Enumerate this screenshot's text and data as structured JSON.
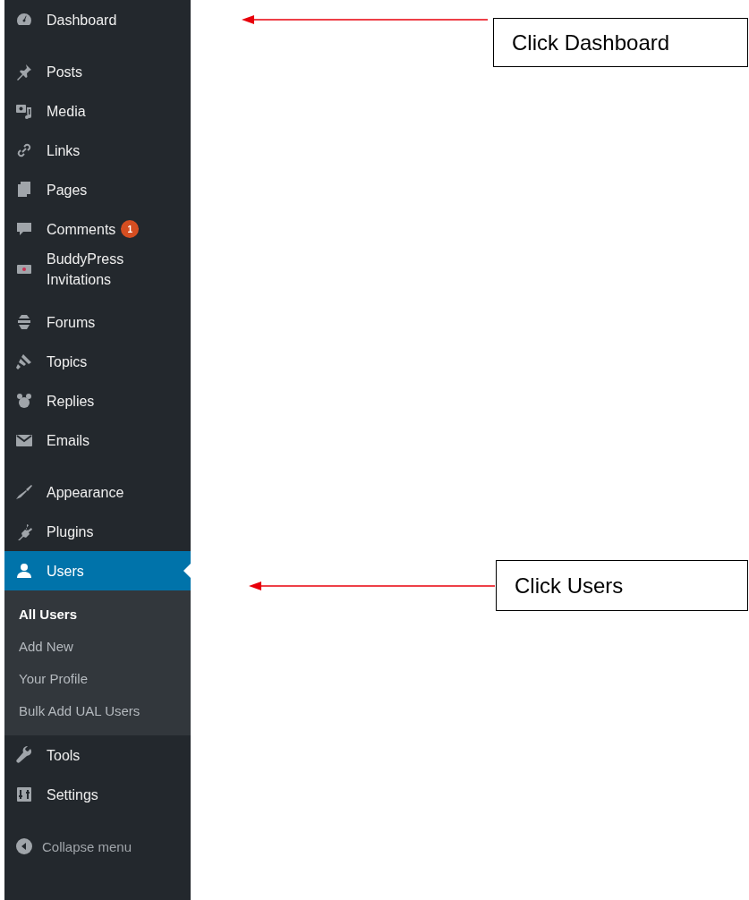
{
  "sidebar": {
    "sections": [
      {
        "items": [
          {
            "label": "Dashboard",
            "selected": false
          }
        ]
      },
      {
        "items": [
          {
            "label": "Posts",
            "selected": false
          },
          {
            "label": "Media",
            "selected": false
          },
          {
            "label": "Links",
            "selected": false
          },
          {
            "label": "Pages",
            "selected": false
          },
          {
            "label": "Comments",
            "selected": false,
            "badge": "1"
          },
          {
            "label": "BuddyPress Invitations",
            "selected": false
          }
        ]
      },
      {
        "items": [
          {
            "label": "Forums",
            "selected": false
          },
          {
            "label": "Topics",
            "selected": false
          },
          {
            "label": "Replies",
            "selected": false
          },
          {
            "label": "Emails",
            "selected": false
          }
        ]
      },
      {
        "items": [
          {
            "label": "Appearance",
            "selected": false
          },
          {
            "label": "Plugins",
            "selected": false
          },
          {
            "label": "Users",
            "selected": true,
            "children": [
              {
                "label": "All Users",
                "selected": true
              },
              {
                "label": "Add New",
                "selected": false
              },
              {
                "label": "Your Profile",
                "selected": false
              },
              {
                "label": "Bulk Add UAL Users",
                "selected": false
              }
            ]
          },
          {
            "label": "Tools",
            "selected": false
          },
          {
            "label": "Settings",
            "selected": false
          }
        ]
      }
    ],
    "collapse_button": {
      "label": "Collapse menu"
    }
  },
  "annotations": [
    {
      "text": "Click Dashboard"
    },
    {
      "text": "Click Users"
    }
  ]
}
